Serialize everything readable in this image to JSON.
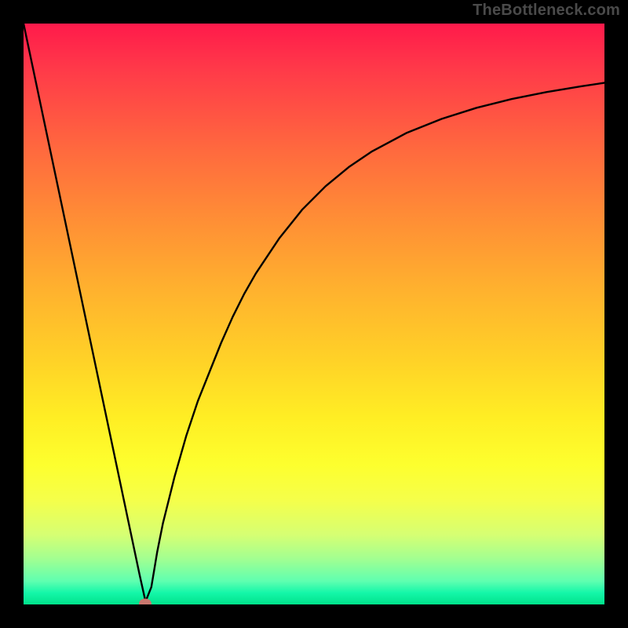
{
  "attribution": "TheBottleneck.com",
  "colors": {
    "frame": "#000000",
    "curve": "#000000",
    "marker": "#c9776e",
    "gradient_top": "#ff1a4b",
    "gradient_bottom": "#00e28a"
  },
  "chart_data": {
    "type": "line",
    "title": "",
    "xlabel": "",
    "ylabel": "",
    "xlim": [
      0,
      100
    ],
    "ylim": [
      0,
      100
    ],
    "x": [
      0,
      2,
      4,
      6,
      8,
      10,
      12,
      14,
      16,
      18,
      20,
      21,
      22,
      23,
      24,
      26,
      28,
      30,
      32,
      34,
      36,
      38,
      40,
      44,
      48,
      52,
      56,
      60,
      66,
      72,
      78,
      84,
      90,
      96,
      100
    ],
    "y": [
      100,
      90.5,
      81,
      71.5,
      62,
      52.5,
      43,
      33.5,
      24,
      14.5,
      5,
      0.5,
      3,
      9,
      14,
      22,
      29,
      35,
      40,
      45,
      49.5,
      53.5,
      57,
      63,
      68,
      72,
      75.3,
      78,
      81.2,
      83.6,
      85.5,
      87,
      88.2,
      89.2,
      89.8
    ],
    "marker": {
      "x": 21,
      "y": 0.2
    },
    "grid": false,
    "legend": false
  }
}
